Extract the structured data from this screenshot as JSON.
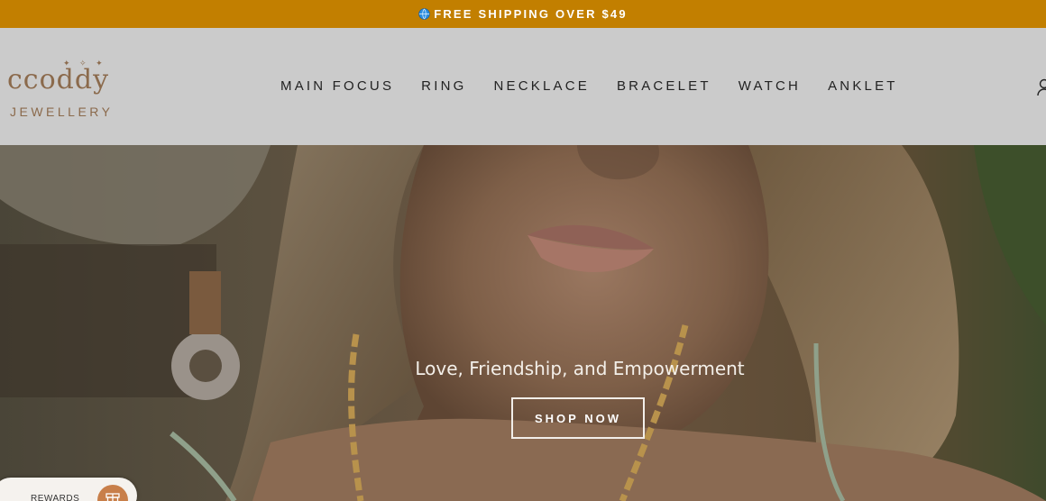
{
  "announcement": {
    "text": "FREE SHIPPING OVER $49",
    "icon": "globe-icon"
  },
  "brand": {
    "name": "ccoddy",
    "subtitle": "JEWELLERY"
  },
  "nav": {
    "items": [
      "MAIN FOCUS",
      "RING",
      "NECKLACE",
      "BRACELET",
      "WATCH",
      "ANKLET"
    ]
  },
  "header_icons": {
    "account": "account-icon"
  },
  "hero": {
    "tagline": "Love, Friendship, and Empowerment",
    "cta_label": "SHOP NOW"
  },
  "rewards": {
    "label": "REWARDS",
    "icon": "gift-icon"
  },
  "colors": {
    "announcement_bg": "#c27f00",
    "header_bg": "#cbcbcb",
    "brand": "#8b6a4c",
    "rewards_badge": "#c87f4a"
  }
}
